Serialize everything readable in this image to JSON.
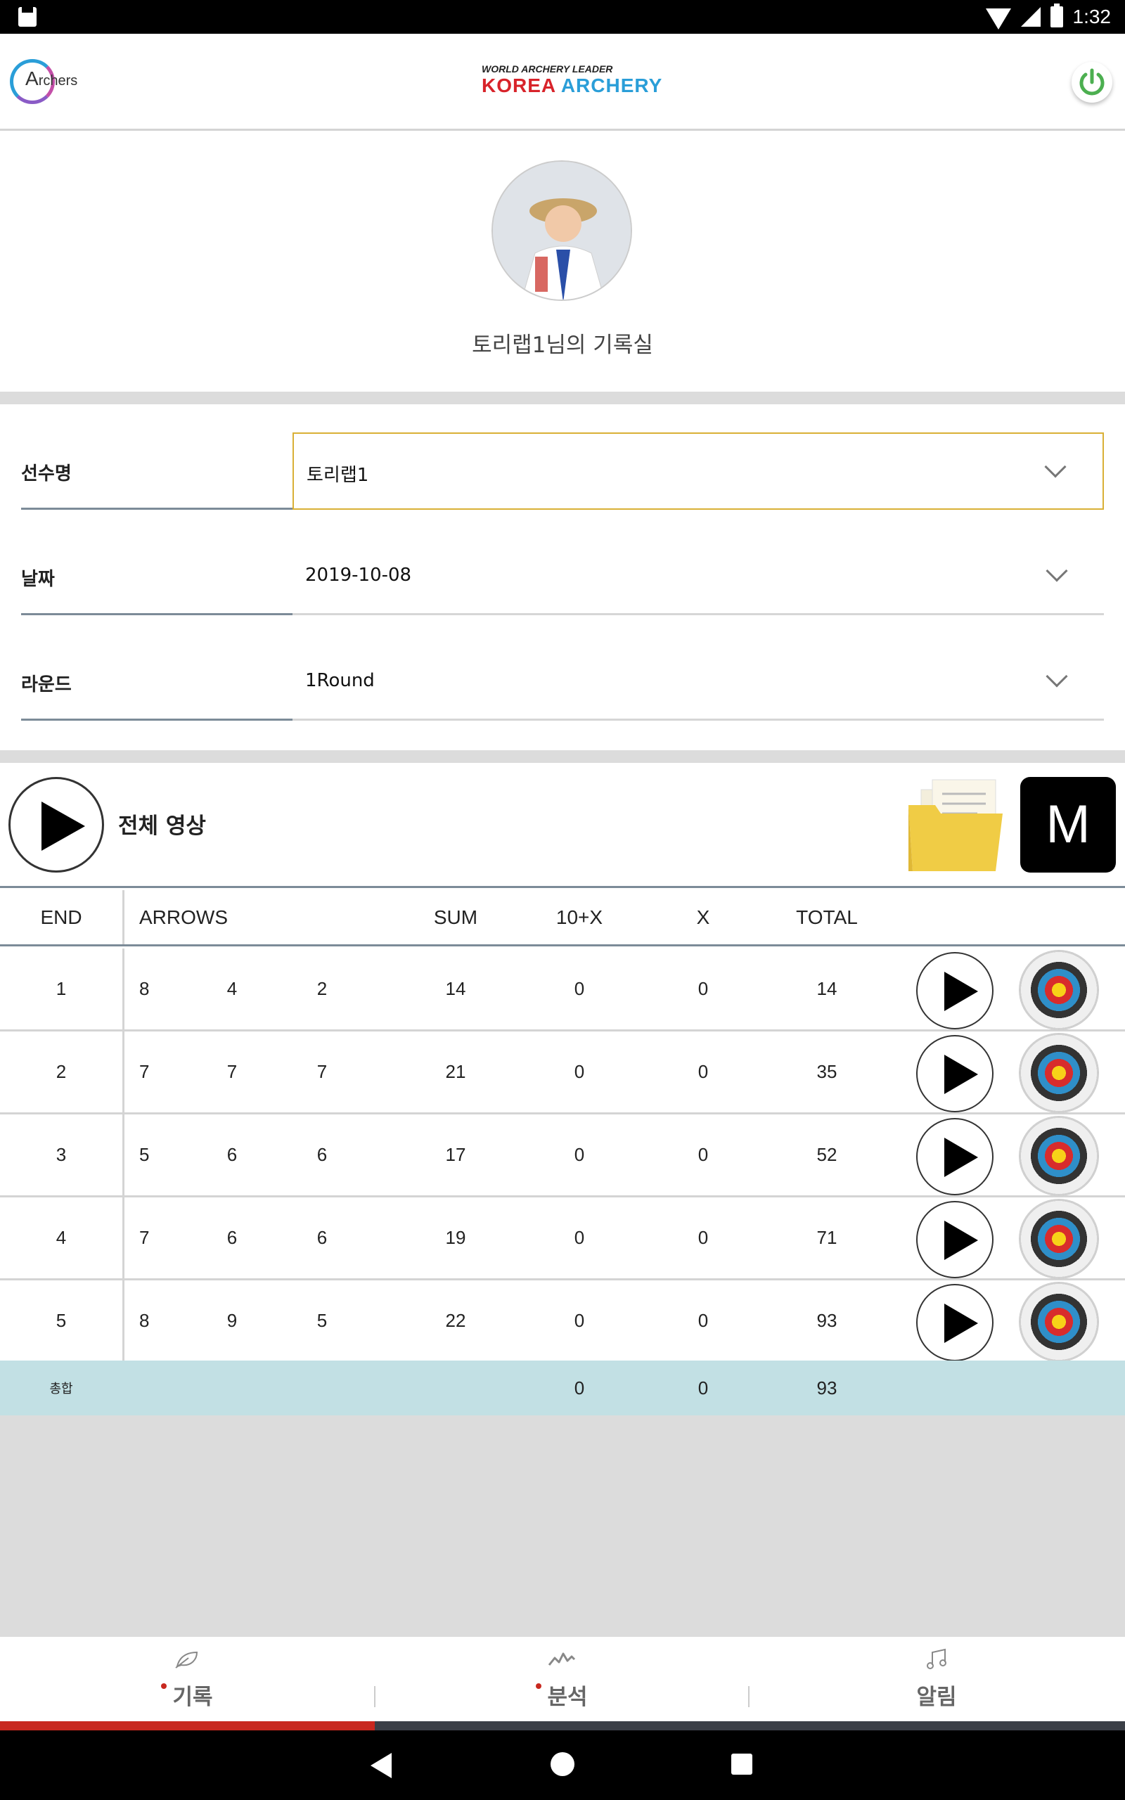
{
  "status_bar": {
    "time": "1:32"
  },
  "header": {
    "brand_left": {
      "initial": "A",
      "rest": "rchers"
    },
    "brand_center": {
      "tagline": "WORLD ARCHERY LEADER",
      "word1": "KOREA",
      "word2": "ARCHERY"
    },
    "power_icon": "power-icon",
    "accent_color": "#4caf50"
  },
  "profile": {
    "title": "토리랩1님의 기록실"
  },
  "form": {
    "player": {
      "label": "선수명",
      "value": "토리랩1"
    },
    "date": {
      "label": "날짜",
      "value": "2019-10-08"
    },
    "round": {
      "label": "라운드",
      "value": "1Round"
    }
  },
  "video": {
    "label": "전체 영상",
    "m_label": "M"
  },
  "table": {
    "headers": {
      "end": "END",
      "arrows": "ARROWS",
      "sum": "SUM",
      "tenx": "10+X",
      "x": "X",
      "total": "TOTAL"
    },
    "rows": [
      {
        "end": "1",
        "a1": "8",
        "a2": "4",
        "a3": "2",
        "sum": "14",
        "tenx": "0",
        "x": "0",
        "total": "14"
      },
      {
        "end": "2",
        "a1": "7",
        "a2": "7",
        "a3": "7",
        "sum": "21",
        "tenx": "0",
        "x": "0",
        "total": "35"
      },
      {
        "end": "3",
        "a1": "5",
        "a2": "6",
        "a3": "6",
        "sum": "17",
        "tenx": "0",
        "x": "0",
        "total": "52"
      },
      {
        "end": "4",
        "a1": "7",
        "a2": "6",
        "a3": "6",
        "sum": "19",
        "tenx": "0",
        "x": "0",
        "total": "71"
      },
      {
        "end": "5",
        "a1": "8",
        "a2": "9",
        "a3": "5",
        "sum": "22",
        "tenx": "0",
        "x": "0",
        "total": "93"
      }
    ],
    "footer": {
      "label": "총합",
      "tenx": "0",
      "x": "0",
      "total": "93"
    }
  },
  "bottom_nav": {
    "items": [
      {
        "label": "기록",
        "icon": "leaf-icon",
        "dot": true
      },
      {
        "label": "분석",
        "icon": "chart-icon",
        "dot": true
      },
      {
        "label": "알림",
        "icon": "music-note-icon",
        "dot": false
      }
    ],
    "active_index": 0,
    "active_color": "#c8281f"
  }
}
